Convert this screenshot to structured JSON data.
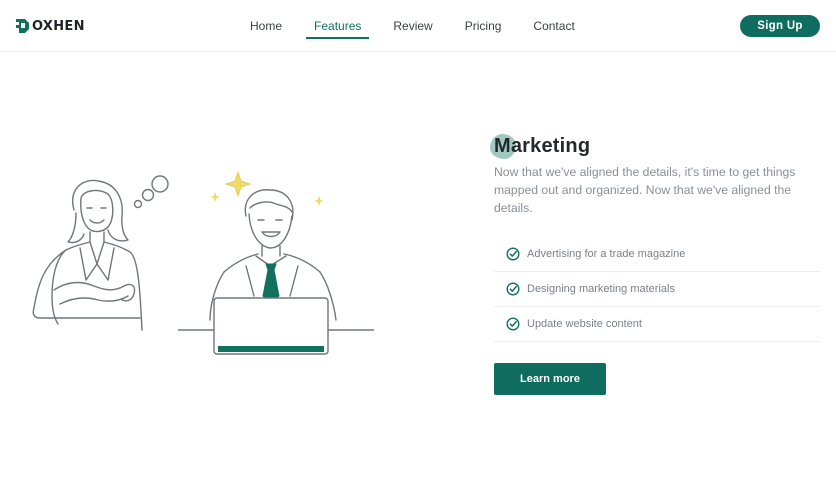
{
  "brand": {
    "name": "OXHEN",
    "logo_icon": "hexagon-logo-icon",
    "accent_color": "#0e6d5e"
  },
  "nav": {
    "items": [
      {
        "label": "Home",
        "active": false
      },
      {
        "label": "Features",
        "active": true
      },
      {
        "label": "Review",
        "active": false
      },
      {
        "label": "Pricing",
        "active": false
      },
      {
        "label": "Contact",
        "active": false
      }
    ],
    "signup_label": "Sign Up"
  },
  "section": {
    "title": "Marketing",
    "description": "Now that we've aligned the details, it's time to get things mapped out and organized. Now that we've aligned the details.",
    "features": [
      {
        "text": "Advertising for a trade magazine",
        "icon": "check-circle-icon"
      },
      {
        "text": "Designing marketing materials",
        "icon": "check-circle-icon"
      },
      {
        "text": "Update website content",
        "icon": "check-circle-icon"
      }
    ],
    "cta_label": "Learn more"
  }
}
